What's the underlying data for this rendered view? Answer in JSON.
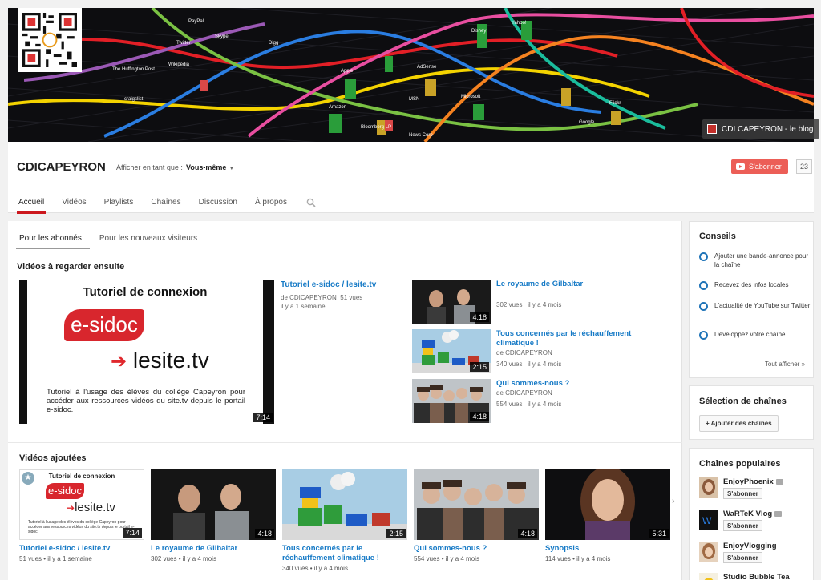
{
  "banner": {
    "station_labels": [
      "PayPal",
      "Skype",
      "Twitter",
      "Wikipedia",
      "The Huffington Post",
      "Apple",
      "Disney",
      "Yahoo!",
      "AdSense",
      "MSN",
      "Microsoft",
      "Amazon",
      "Bloomberg LP",
      "News Corp",
      "Flickr",
      "Google",
      "Digg",
      "craigslist"
    ],
    "blog_link": "CDI CAPEYRON - le blog"
  },
  "channel": {
    "title": "CDICAPEYRON",
    "view_as_label": "Afficher en tant que :",
    "view_as_value": "Vous-même",
    "subscribe_label": "S'abonner",
    "subscriber_count": "23"
  },
  "tabs": [
    "Accueil",
    "Vidéos",
    "Playlists",
    "Chaînes",
    "Discussion",
    "À propos"
  ],
  "subtabs": [
    "Pour les abonnés",
    "Pour les nouveaux visiteurs"
  ],
  "watch_next": {
    "title": "Vidéos à regarder ensuite",
    "featured": {
      "thumb_heading": "Tutoriel de connexion",
      "thumb_logo1": "e-sidoc",
      "thumb_logo2": "lesite.tv",
      "thumb_caption": "Tutoriel à l'usage des élèves du collège Capeyron pour accéder aux ressources vidéos du site.tv depuis le portail e-sidoc.",
      "duration": "7:14",
      "title": "Tutoriel e-sidoc / lesite.tv",
      "by": "de CDICAPEYRON",
      "views": "51 vues",
      "age": "il y a 1 semaine"
    },
    "side": [
      {
        "title": "Le royaume de Gilbaltar",
        "by": "de CDICAPEYRON",
        "views": "302 vues",
        "age": "il y a 4 mois",
        "duration": "4:18"
      },
      {
        "title": "Tous concernés par le réchauffement climatique !",
        "by": "de CDICAPEYRON",
        "views": "340 vues",
        "age": "il y a 4 mois",
        "duration": "2:15"
      },
      {
        "title": "Qui sommes-nous ?",
        "by": "de CDICAPEYRON",
        "views": "554 vues",
        "age": "il y a 4 mois",
        "duration": "4:18"
      }
    ]
  },
  "added": {
    "title": "Vidéos ajoutées",
    "items": [
      {
        "title": "Tutoriel e-sidoc / lesite.tv",
        "meta": "51 vues  •  il y a 1 semaine",
        "duration": "7:14"
      },
      {
        "title": "Le royaume de Gilbaltar",
        "meta": "302 vues  •  il y a 4 mois",
        "duration": "4:18"
      },
      {
        "title": "Tous concernés par le réchauffement climatique !",
        "meta": "340 vues  •  il y a 4 mois",
        "duration": "2:15"
      },
      {
        "title": "Qui sommes-nous ?",
        "meta": "554 vues  •  il y a 4 mois",
        "duration": "4:18"
      },
      {
        "title": "Synopsis",
        "meta": "114 vues  •  il y a 4 mois",
        "duration": "5:31"
      }
    ]
  },
  "tips": {
    "title": "Conseils",
    "items": [
      "Ajouter une bande-annonce pour la chaîne",
      "Recevez des infos locales",
      "L'actualité de YouTube sur Twitter",
      "Développez votre chaîne"
    ],
    "show_all": "Tout afficher  »"
  },
  "channel_selection": {
    "title": "Sélection de chaînes",
    "add_button": "+ Ajouter des chaînes"
  },
  "popular": {
    "title": "Chaînes populaires",
    "subscribe_label": "S'abonner",
    "items": [
      "EnjoyPhoenix",
      "WaRTeK Vlog",
      "EnjoyVlogging",
      "Studio Bubble Tea"
    ]
  },
  "colors": {
    "accent": "#cc181e",
    "link": "#167ac6",
    "tip_ring": "#2074b8"
  }
}
